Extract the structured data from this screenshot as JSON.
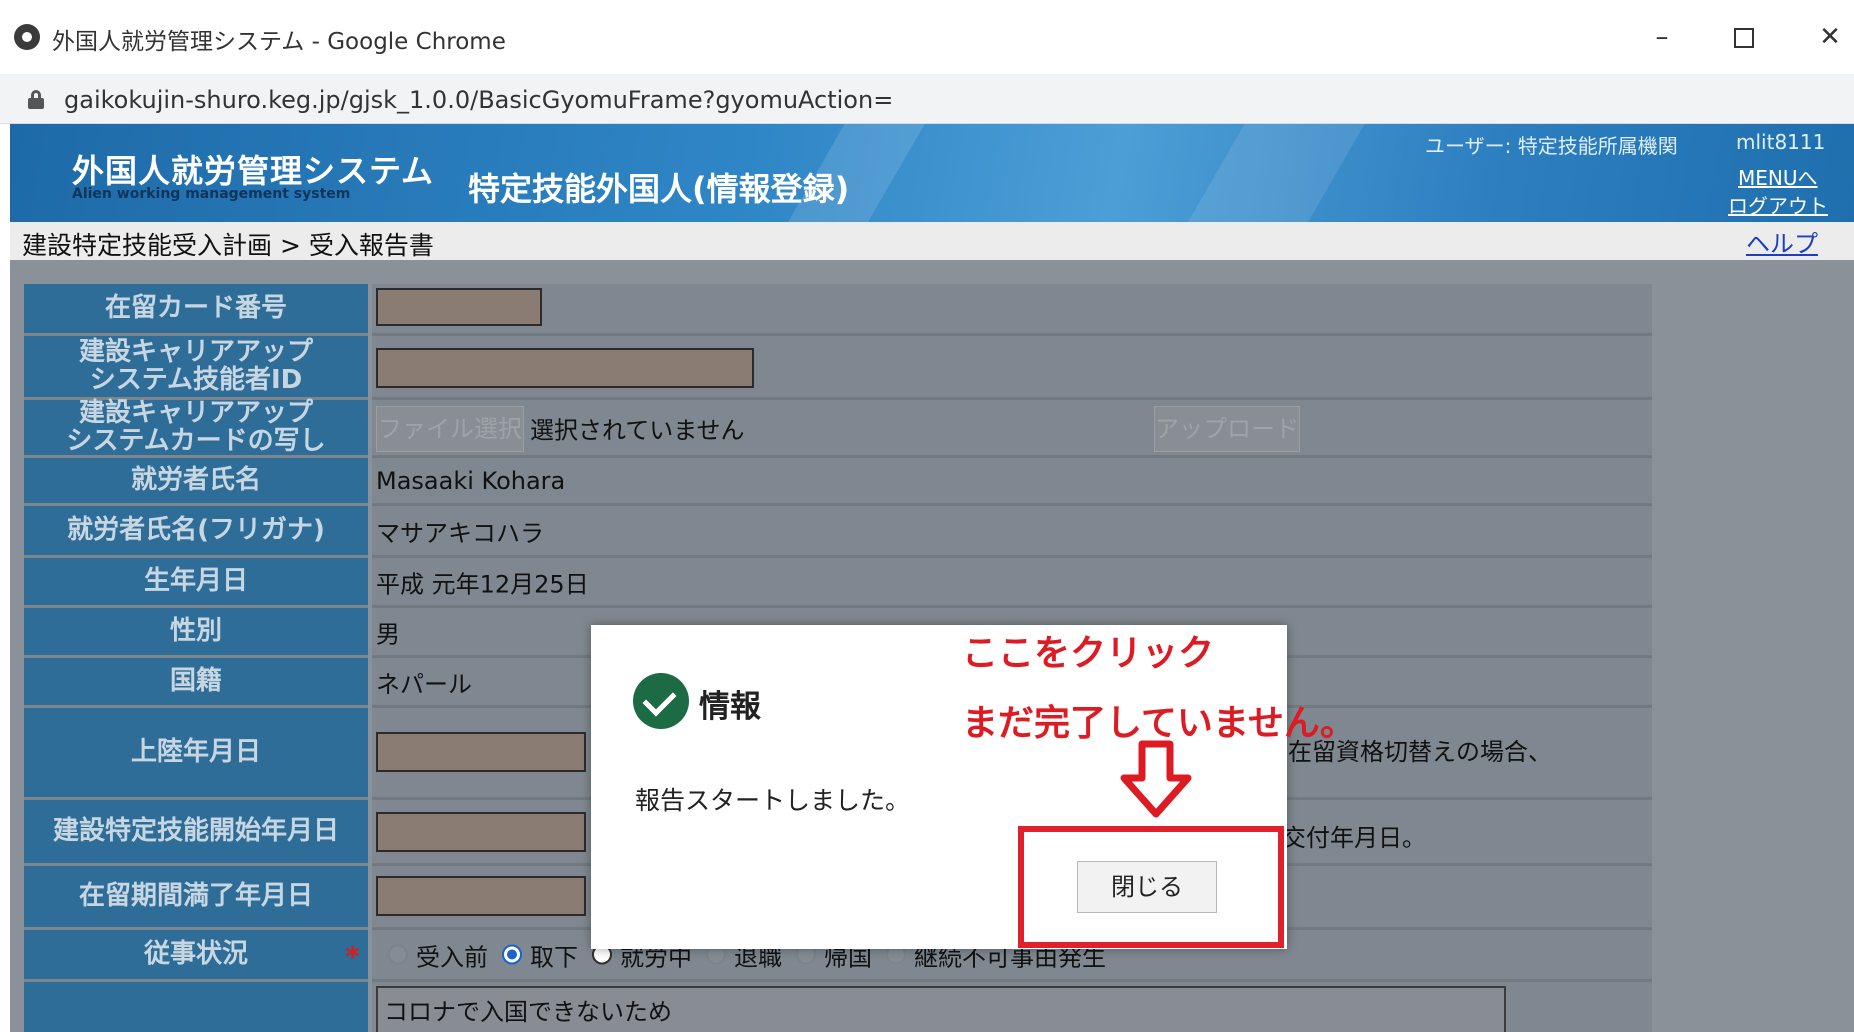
{
  "window": {
    "title": "外国人就労管理システム - Google Chrome",
    "minimize_icon": "minimize-icon",
    "maximize_icon": "maximize-icon",
    "close_glyph": "✕"
  },
  "address_bar": {
    "url": "gaikokujin-shuro.keg.jp/gjsk_1.0.0/BasicGyomuFrame?gyomuAction="
  },
  "header": {
    "app_name": "外国人就労管理システム",
    "app_name_en": "Alien working management system",
    "page_title": "特定技能外国人(情報登録)",
    "user_label": "ユーザー: 特定技能所属機関",
    "user_id": "mlit8111",
    "menu_link": "MENUへ",
    "logout_link": "ログアウト"
  },
  "breadcrumb": {
    "text": "建設特定技能受入計画 > 受入報告書",
    "help_link": "ヘルプ"
  },
  "form": {
    "rows": [
      {
        "label": "在留カード番号"
      },
      {
        "label": "建設キャリアアップシステム技能者ID",
        "label_lines": [
          "建設キャリアアップ",
          "システム技能者ID"
        ]
      },
      {
        "label": "建設キャリアアップシステムカードの写し",
        "label_lines": [
          "建設キャリアアップ",
          "システムカードの写し"
        ],
        "file_button": "ファイル選択",
        "file_status": "選択されていません",
        "upload_button": "アップロード"
      },
      {
        "label": "就労者氏名",
        "value": "Masaaki Kohara"
      },
      {
        "label": "就労者氏名(フリガナ)",
        "value": "マサアキコハラ"
      },
      {
        "label": "生年月日",
        "value": "平成 元年12月25日"
      },
      {
        "label": "性別",
        "value": "男"
      },
      {
        "label": "国籍",
        "value": "ネパール"
      },
      {
        "label": "上陸年月日",
        "note": "在留資格切替えの場合、"
      },
      {
        "label": "建設特定技能開始年月日",
        "note": "交付年月日。"
      },
      {
        "label": "在留期間満了年月日"
      },
      {
        "label": "従事状況",
        "required_mark": "*",
        "options": [
          "受入前",
          "取下",
          "就労中",
          "退職",
          "帰国",
          "継続不可事由発生"
        ],
        "selected": "取下"
      },
      {
        "label": "",
        "value": "コロナで入国できないため"
      }
    ]
  },
  "dialog": {
    "title": "情報",
    "message": "報告スタートしました。",
    "close_button": "閉じる"
  },
  "annotations": {
    "line1": "ここをクリック",
    "line2": "まだ完了していません。",
    "color": "#dc1b23"
  }
}
